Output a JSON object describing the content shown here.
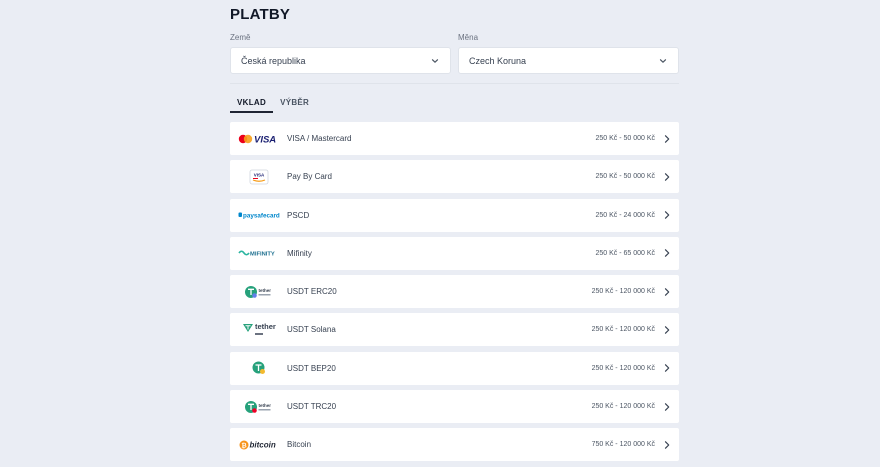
{
  "title": "PLATBY",
  "filters": {
    "country": {
      "label": "Země",
      "value": "Česká republika"
    },
    "currency": {
      "label": "Měna",
      "value": "Czech Koruna"
    }
  },
  "tabs": [
    {
      "label": "VKLAD",
      "active": true
    },
    {
      "label": "VÝBĚR",
      "active": false
    }
  ],
  "methods": [
    {
      "name": "VISA / Mastercard",
      "range": "250 Kč - 50 000 Kč",
      "logo": "visa-mastercard",
      "logo_text": "VISA"
    },
    {
      "name": "Pay By Card",
      "range": "250 Kč - 50 000 Kč",
      "logo": "paybycard",
      "logo_text": "VISA"
    },
    {
      "name": "PSCD",
      "range": "250 Kč - 24 000 Kč",
      "logo": "paysafecard",
      "logo_text": "paysafecard"
    },
    {
      "name": "Mifinity",
      "range": "250 Kč - 65 000 Kč",
      "logo": "mifinity",
      "logo_text": "MIFINITY"
    },
    {
      "name": "USDT ERC20",
      "range": "250 Kč - 120 000 Kč",
      "logo": "tether-erc20",
      "logo_text": "tether"
    },
    {
      "name": "USDT Solana",
      "range": "250 Kč - 120 000 Kč",
      "logo": "tether-sol",
      "logo_text": "tether"
    },
    {
      "name": "USDT BEP20",
      "range": "250 Kč - 120 000 Kč",
      "logo": "tether-bep20",
      "logo_text": ""
    },
    {
      "name": "USDT TRC20",
      "range": "250 Kč - 120 000 Kč",
      "logo": "tether-trc20",
      "logo_text": "tether"
    },
    {
      "name": "Bitcoin",
      "range": "750 Kč - 120 000 Kč",
      "logo": "bitcoin",
      "logo_text": "bitcoin"
    }
  ],
  "colors": {
    "background": "#eaedf4",
    "visa": "#1a1f71",
    "mastercard_red": "#eb001b",
    "mastercard_orange": "#f79e1b",
    "tether": "#26a17b",
    "paysafe": "#0087cc",
    "bitcoin": "#f7931a"
  }
}
